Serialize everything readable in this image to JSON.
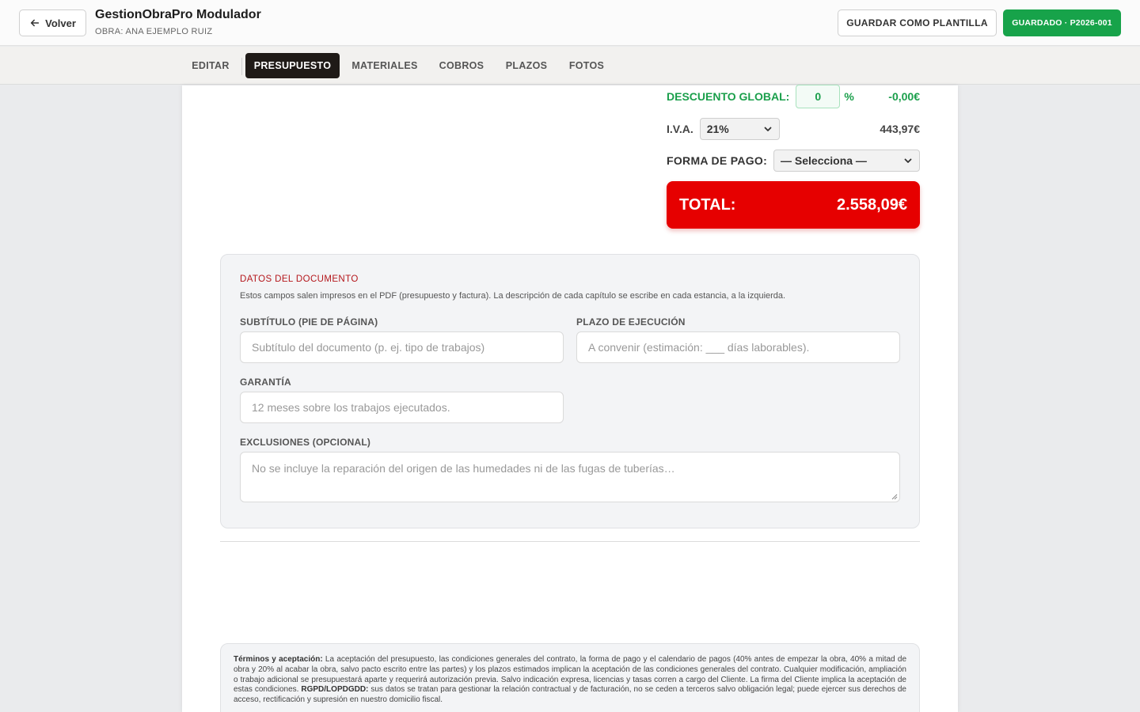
{
  "header": {
    "back_label": "Volver",
    "app_title": "GestionObraPro Modulador",
    "subtitle": "OBRA: ANA EJEMPLO RUIZ",
    "template_button": "GUARDAR COMO PLANTILLA",
    "saved_button": "GUARDADO · P2026-001"
  },
  "tabs": [
    {
      "label": "EDITAR",
      "active": false
    },
    {
      "label": "PRESUPUESTO",
      "active": true
    },
    {
      "label": "MATERIALES",
      "active": false
    },
    {
      "label": "COBROS",
      "active": false
    },
    {
      "label": "PLAZOS",
      "active": false
    },
    {
      "label": "FOTOS",
      "active": false
    }
  ],
  "summary": {
    "discount_label": "DESCUENTO GLOBAL:",
    "discount_value": "0",
    "discount_unit": "%",
    "discount_amount": "-0,00€",
    "iva_label": "I.V.A.",
    "iva_selected": "21%",
    "iva_amount": "443,97€",
    "payment_label": "FORMA DE PAGO:",
    "payment_selected": "— Selecciona —",
    "total_label": "TOTAL:",
    "total_value": "2.558,09€"
  },
  "datos": {
    "title": "DATOS DEL DOCUMENTO",
    "description": "Estos campos salen impresos en el PDF (presupuesto y factura). La descripción de cada capítulo se escribe en cada estancia, a la izquierda.",
    "subtitulo_label": "SUBTÍTULO (PIE DE PÁGINA)",
    "subtitulo_placeholder": "Subtítulo del documento (p. ej. tipo de trabajos)",
    "plazo_label": "PLAZO DE EJECUCIÓN",
    "plazo_placeholder": "A convenir (estimación: ___ días laborables).",
    "garantia_label": "GARANTÍA",
    "garantia_placeholder": "12 meses sobre los trabajos ejecutados.",
    "exclusiones_label": "EXCLUSIONES (OPCIONAL)",
    "exclusiones_placeholder": "No se incluye la reparación del origen de las humedades ni de las fugas de tuberías…"
  },
  "terms": {
    "heading": "Términos y aceptación:",
    "body": " La aceptación del presupuesto, las condiciones generales del contrato, la forma de pago y el calendario de pagos (40% antes de empezar la obra, 40% a mitad de obra y 20% al acabar la obra, salvo pacto escrito entre las partes) y los plazos estimados implican la aceptación de las condiciones generales del contrato. Cualquier modificación, ampliación o trabajo adicional se presupuestará aparte y requerirá autorización previa. Salvo indicación expresa, licencias y tasas corren a cargo del Cliente. La firma del Cliente implica la aceptación de estas condiciones. ",
    "gdpr_heading": "RGPD/LOPDGDD:",
    "gdpr_body": " sus datos se tratan para gestionar la relación contractual y de facturación, no se ceden a terceros salvo obligación legal; puede ejercer sus derechos de acceso, rectificación y supresión en nuestro domicilio fiscal."
  }
}
